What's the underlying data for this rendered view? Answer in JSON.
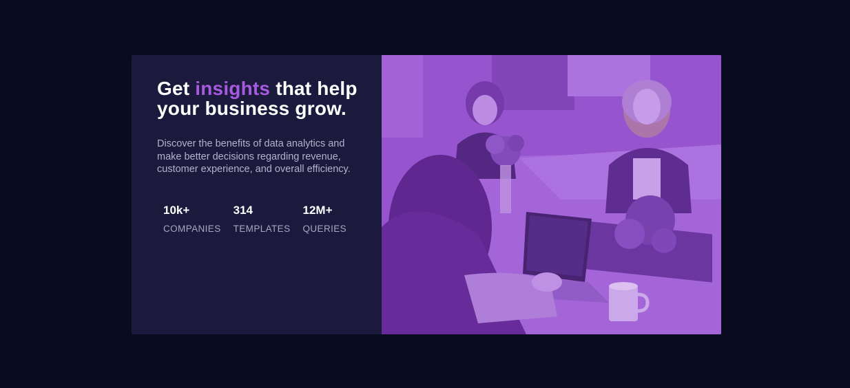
{
  "hero": {
    "headline_start": "Get ",
    "headline_accent": "insights",
    "headline_end": " that help your business grow.",
    "description": "Discover the benefits of data analytics and make better decisions regarding revenue, customer experience, and overall efficiency.",
    "stats": [
      {
        "value": "10k+",
        "label": "COMPANIES"
      },
      {
        "value": "314",
        "label": "TEMPLATES"
      },
      {
        "value": "12M+",
        "label": "QUERIES"
      }
    ]
  },
  "image": {
    "subject": "office-team-photo",
    "overlay_color": "#a05ad8"
  },
  "colors": {
    "page_background": "#090b1e",
    "panel_background": "#1b1a3c",
    "accent": "#a65adf",
    "text_primary": "#ffffff",
    "text_muted": "#b6b2cc"
  }
}
